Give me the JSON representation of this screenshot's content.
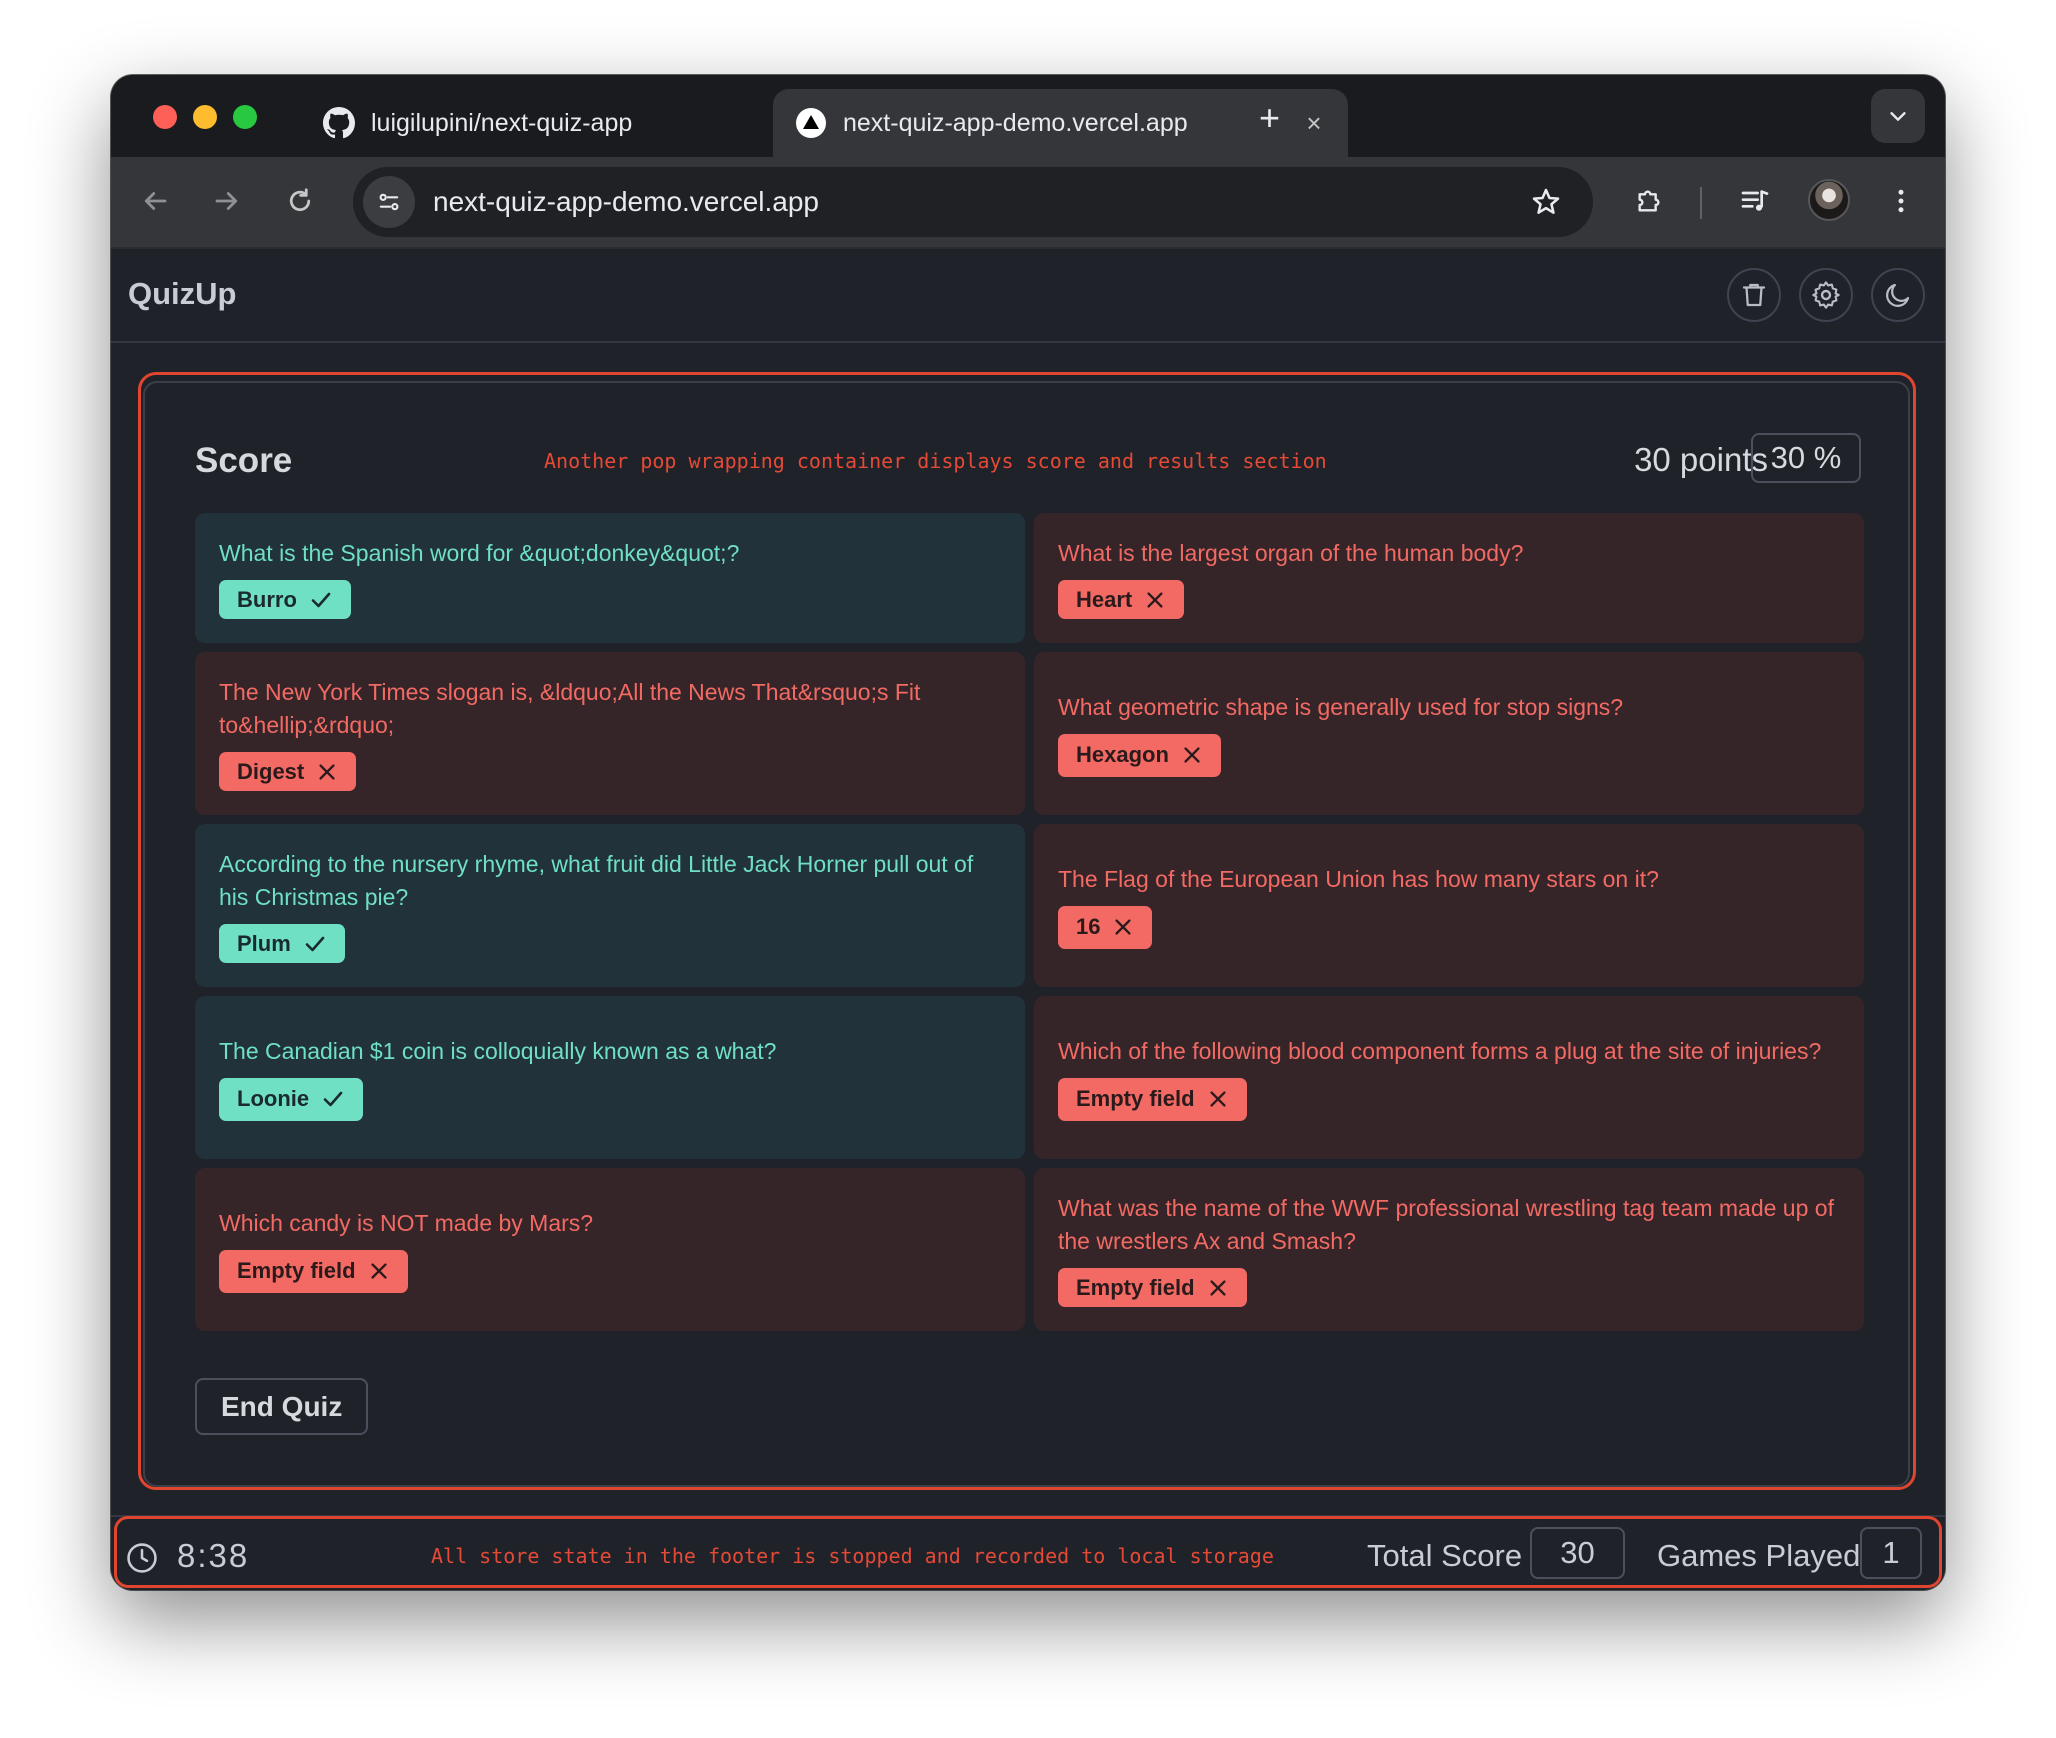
{
  "browser": {
    "tabs": [
      {
        "title": "luigilupini/next-quiz-app",
        "icon": "github-icon",
        "active": false
      },
      {
        "title": "next-quiz-app-demo.vercel.app",
        "icon": "vercel-icon",
        "active": true
      }
    ],
    "new_tab_label": "+",
    "close_label": "×",
    "url": "next-quiz-app-demo.vercel.app"
  },
  "app": {
    "title": "QuizUp",
    "header_icons": [
      "trash-icon",
      "gear-icon",
      "moon-icon"
    ]
  },
  "score": {
    "title": "Score",
    "annotation": "Another pop wrapping container displays score and results section",
    "points_label": "30 points",
    "percent_label": "30 %",
    "questions": [
      {
        "question": "What is the Spanish word for &quot;donkey&quot;?",
        "answer": "Burro",
        "correct": true
      },
      {
        "question": "What is the largest organ of the human body?",
        "answer": "Heart",
        "correct": false
      },
      {
        "question": "The New York Times slogan is, &ldquo;All the News That&rsquo;s Fit to&hellip;&rdquo;",
        "answer": "Digest",
        "correct": false
      },
      {
        "question": "What geometric shape is generally used for stop signs?",
        "answer": "Hexagon",
        "correct": false
      },
      {
        "question": "According to the nursery rhyme, what fruit did Little Jack Horner pull out of his Christmas pie?",
        "answer": "Plum",
        "correct": true
      },
      {
        "question": "The Flag of the European Union has how many stars on it?",
        "answer": "16",
        "correct": false
      },
      {
        "question": "The Canadian $1 coin is colloquially known as a what?",
        "answer": "Loonie",
        "correct": true
      },
      {
        "question": "Which of the following blood component forms a plug at the site of injuries?",
        "answer": "Empty field",
        "correct": false
      },
      {
        "question": "Which candy is NOT made by Mars?",
        "answer": "Empty field",
        "correct": false
      },
      {
        "question": "What was the name of the WWF professional wrestling tag team made up of the wrestlers Ax and Smash?",
        "answer": "Empty field",
        "correct": false
      }
    ],
    "end_quiz_label": "End Quiz"
  },
  "footer": {
    "timer": "8:38",
    "annotation": "All store state in the footer is stopped and recorded to local storage",
    "total_score_label": "Total Score",
    "total_score_value": "30",
    "games_played_label": "Games Played",
    "games_played_value": "1"
  },
  "colors": {
    "correct": "#6fe0c3",
    "wrong": "#f26a63",
    "annotation": "#e0452f"
  }
}
